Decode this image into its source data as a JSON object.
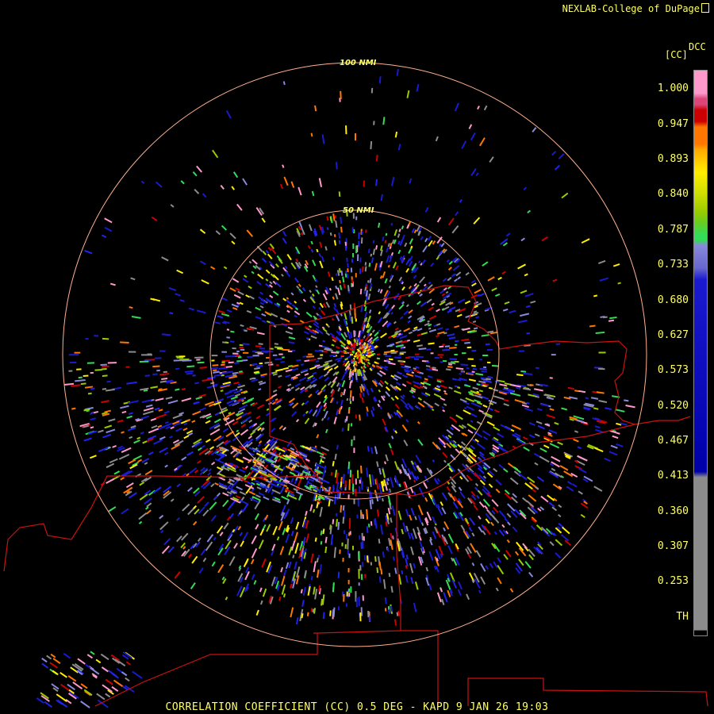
{
  "credit": "NEXLAB-College of DuPage",
  "legend": {
    "title": "DCC",
    "product": "[CC]",
    "ticks": [
      "1.000",
      "0.947",
      "0.893",
      "0.840",
      "0.787",
      "0.733",
      "0.680",
      "0.627",
      "0.573",
      "0.520",
      "0.467",
      "0.413",
      "0.360",
      "0.307",
      "0.253",
      "TH"
    ],
    "colors": {
      "pink": "#ff99cc",
      "red": "#cc0000",
      "orange": "#ff7700",
      "yellow": "#ffee00",
      "olive": "#99cc00",
      "green": "#33dd55",
      "lavender": "#8888dd",
      "blue": "#1a1ad0",
      "darkblue": "#0000aa",
      "gray": "#8c8c8c",
      "black": "#000000"
    }
  },
  "rings": {
    "inner_label": "50 NMI",
    "outer_label": "100 NMI"
  },
  "footer": "CORRELATION COEFFICIENT (CC) 0.5 DEG - KAPD 9 JAN 26 19:03",
  "map": {
    "ring_color": "#ffb090",
    "border_color": "#cc1111"
  }
}
